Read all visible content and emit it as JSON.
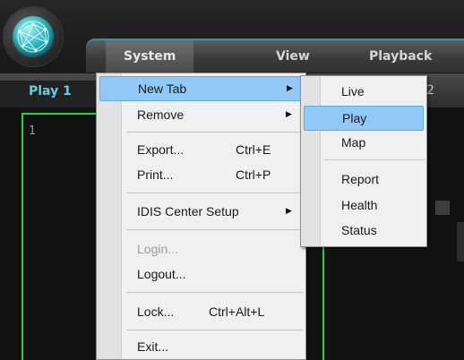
{
  "menubar": {
    "items": [
      {
        "label": "System",
        "active": true
      },
      {
        "label": "View",
        "active": false
      },
      {
        "label": "Playback",
        "active": false
      }
    ]
  },
  "tabs": {
    "play1": "Play 1",
    "second_tab_number": "2"
  },
  "video": {
    "pane_number": "1"
  },
  "system_menu": {
    "items": [
      {
        "label": "New Tab",
        "submenu": true
      },
      {
        "label": "Remove",
        "submenu": true
      },
      {
        "label": "Export...",
        "shortcut": "Ctrl+E"
      },
      {
        "label": "Print...",
        "shortcut": "Ctrl+P"
      },
      {
        "label": "IDIS Center Setup",
        "submenu": true
      },
      {
        "label": "Login...",
        "disabled": true
      },
      {
        "label": "Logout..."
      },
      {
        "label": "Lock...",
        "shortcut": "Ctrl+Alt+L"
      },
      {
        "label": "Exit..."
      }
    ]
  },
  "newtab_submenu": {
    "items": [
      "Live",
      "Play",
      "Map",
      "Report",
      "Health",
      "Status"
    ]
  },
  "colors": {
    "accent": "#2a93a6",
    "highlight": "#90c8f6",
    "pane_border": "#28d23a",
    "tab_text": "#5ed0ec"
  }
}
